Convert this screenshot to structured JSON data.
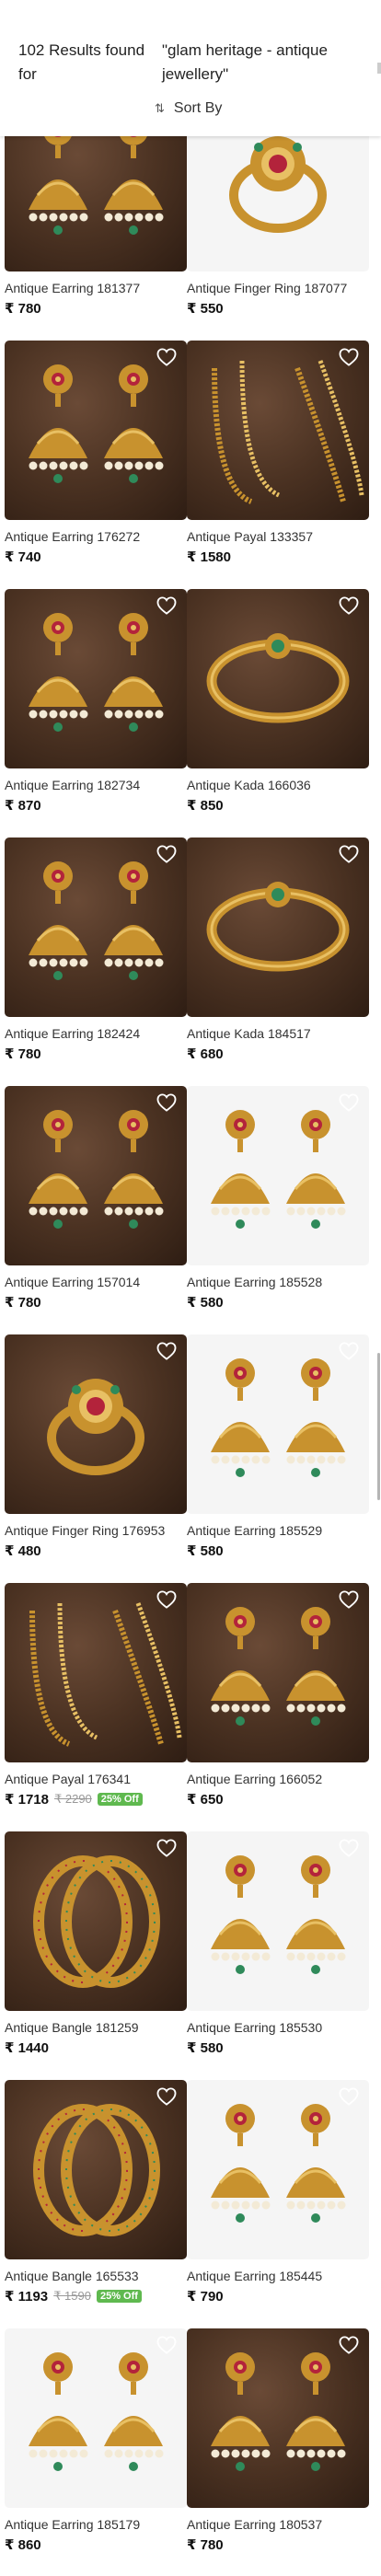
{
  "header": {
    "results_count": "102 Results found for",
    "search_query": "\"glam heritage - antique jewellery\"",
    "sort_label": "Sort By"
  },
  "currency": "₹",
  "products": [
    {
      "name": "Antique Earring 181377",
      "price": "₹ 780",
      "image": "earring-icon",
      "bg": "dark",
      "wishlist": false
    },
    {
      "name": "Antique Finger Ring 187077",
      "price": "₹ 550",
      "image": "ring-icon",
      "bg": "light",
      "wishlist": false
    },
    {
      "name": "Antique Earring 176272",
      "price": "₹ 740",
      "image": "earring-icon",
      "bg": "dark",
      "wishlist": true
    },
    {
      "name": "Antique Payal 133357",
      "price": "₹ 1580",
      "image": "payal-icon",
      "bg": "dark",
      "wishlist": true
    },
    {
      "name": "Antique Earring 182734",
      "price": "₹ 870",
      "image": "earring-icon",
      "bg": "dark",
      "wishlist": true
    },
    {
      "name": "Antique Kada 166036",
      "price": "₹ 850",
      "image": "kada-icon",
      "bg": "dark",
      "wishlist": true
    },
    {
      "name": "Antique Earring 182424",
      "price": "₹ 780",
      "image": "earring-icon",
      "bg": "dark",
      "wishlist": true
    },
    {
      "name": "Antique Kada 184517",
      "price": "₹ 680",
      "image": "kada-icon",
      "bg": "dark",
      "wishlist": true
    },
    {
      "name": "Antique Earring 157014",
      "price": "₹ 780",
      "image": "earring-icon",
      "bg": "dark",
      "wishlist": true
    },
    {
      "name": "Antique Earring 185528",
      "price": "₹ 580",
      "image": "earring-icon",
      "bg": "light",
      "wishlist": true
    },
    {
      "name": "Antique Finger Ring 176953",
      "price": "₹ 480",
      "image": "ring-icon",
      "bg": "dark",
      "wishlist": true
    },
    {
      "name": "Antique Earring 185529",
      "price": "₹ 580",
      "image": "earring-icon",
      "bg": "light",
      "wishlist": true
    },
    {
      "name": "Antique Payal 176341",
      "price": "₹ 1718",
      "mrp": "₹ 2290",
      "discount": "25% Off",
      "image": "payal-icon",
      "bg": "dark",
      "wishlist": true
    },
    {
      "name": "Antique Earring 166052",
      "price": "₹ 650",
      "image": "earring-icon",
      "bg": "dark",
      "wishlist": true
    },
    {
      "name": "Antique Bangle 181259",
      "price": "₹ 1440",
      "image": "bangle-icon",
      "bg": "dark",
      "wishlist": true
    },
    {
      "name": "Antique Earring 185530",
      "price": "₹ 580",
      "image": "earring-icon",
      "bg": "light",
      "wishlist": true
    },
    {
      "name": "Antique Bangle 165533",
      "price": "₹ 1193",
      "mrp": "₹ 1590",
      "discount": "25% Off",
      "image": "bangle-icon",
      "bg": "dark",
      "wishlist": true
    },
    {
      "name": "Antique Earring 185445",
      "price": "₹ 790",
      "image": "earring-icon",
      "bg": "light",
      "wishlist": true
    },
    {
      "name": "Antique Earring 185179",
      "price": "₹ 860",
      "image": "earring-icon",
      "bg": "light",
      "wishlist": true
    },
    {
      "name": "Antique Earring 180537",
      "price": "₹ 780",
      "image": "earring-icon",
      "bg": "dark",
      "wishlist": true
    }
  ],
  "colors": {
    "gold": "#c8922e",
    "gold_light": "#e8c064",
    "ruby": "#b3233b",
    "emerald": "#2f8a5a",
    "pearl": "#f3ead6",
    "discount_green": "#5fb94f"
  }
}
